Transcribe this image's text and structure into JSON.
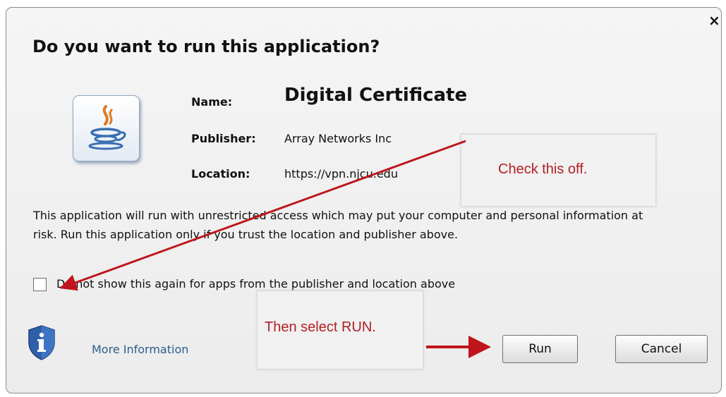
{
  "dialog": {
    "title": "Do you want to run this application?",
    "close_glyph": "×",
    "icon": "java-icon",
    "fields": {
      "name_label": "Name:",
      "name_value": "Digital Certificate",
      "publisher_label": "Publisher:",
      "publisher_value": "Array Networks Inc",
      "location_label": "Location:",
      "location_value": "https://vpn.njcu.edu"
    },
    "warning_text": "This application will run with unrestricted access which may put your computer and personal information at risk. Run this application only if you trust the location and publisher above.",
    "checkbox": {
      "label": "Do not show this again for apps from the publisher and location above",
      "checked": false
    },
    "more_info": {
      "label": "More Information",
      "icon": "shield-info-icon"
    },
    "buttons": {
      "run": "Run",
      "cancel": "Cancel"
    }
  },
  "annotations": {
    "note_check": "Check this off.",
    "note_run": "Then select RUN.",
    "arrow_color": "#c0151c"
  }
}
